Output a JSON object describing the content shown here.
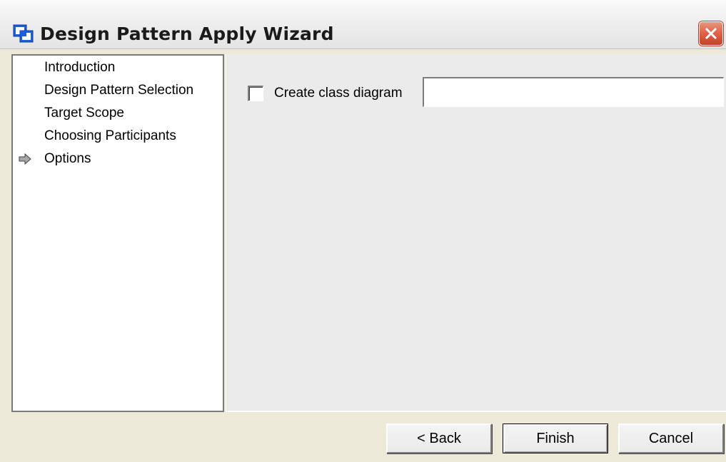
{
  "window": {
    "title": "Design Pattern Apply Wizard",
    "app_icon": "wizard-app-icon",
    "close_icon": "close-icon"
  },
  "steps": [
    {
      "label": "Introduction",
      "current": false
    },
    {
      "label": "Design Pattern Selection",
      "current": false
    },
    {
      "label": "Target Scope",
      "current": false
    },
    {
      "label": "Choosing Participants",
      "current": false
    },
    {
      "label": "Options",
      "current": true
    }
  ],
  "options": {
    "create_class_diagram_label": "Create class diagram",
    "create_class_diagram_checked": false,
    "diagram_name_value": ""
  },
  "buttons": {
    "back": "< Back",
    "finish": "Finish",
    "cancel": "Cancel"
  },
  "colors": {
    "close_button": "#e0654a",
    "app_icon_blue": "#1f5fd8",
    "panel_background": "#ebebeb"
  }
}
